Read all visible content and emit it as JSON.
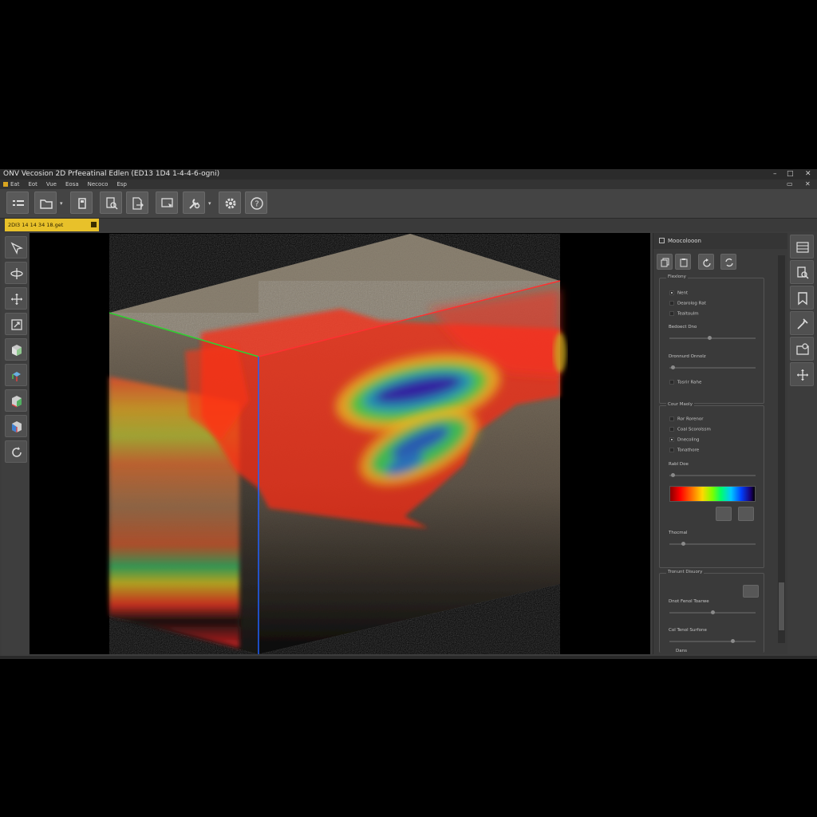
{
  "window": {
    "title": "ONV Vecosion 2D Prfeeatinal Edlen (ED13 1D4 1-4-4-6-ogni)"
  },
  "menu": {
    "items": [
      "Eat",
      "Eot",
      "Vue",
      "Eosa",
      "Necoco",
      "Esp"
    ]
  },
  "tab": {
    "label": "2DI3 14 14 34 18.get"
  },
  "panel": {
    "header": "Moocolooon",
    "group1": {
      "title": "Flexlony",
      "opt1": "Nent",
      "opt2": "Dearolog Rat",
      "opt3": "Tealtoulm",
      "slider1_label": "Bedoect Dno",
      "slider1_value": 0.47,
      "slider2_label": "Dronnurd Onnolz",
      "slider2_value": 0.02,
      "opt4": "Tosrir Rahe"
    },
    "group2": {
      "title": "Cour Maoly",
      "opt1": "Ror Rorenor",
      "opt2": "Coal Scorolssm",
      "opt3": "Dnecoling",
      "opt4": "Tonathore",
      "slider1_label": "Rabl Doe",
      "slider1_value": 0.02,
      "slider2_label": "Thocmal",
      "slider2_value": 0.15
    },
    "group3": {
      "title": "Tronunt Disuory",
      "slider1_label": "Dnot Fenol Toarwe",
      "slider1_value": 0.5,
      "slider2_label": "Col Tenol Surfone",
      "slider2_value": 0.75,
      "footer_label": "Dans"
    }
  },
  "colors": {
    "tab_accent": "#e8c12a",
    "axis_x": "#ff3030",
    "axis_y": "#2060ff",
    "axis_z": "#30d030"
  }
}
